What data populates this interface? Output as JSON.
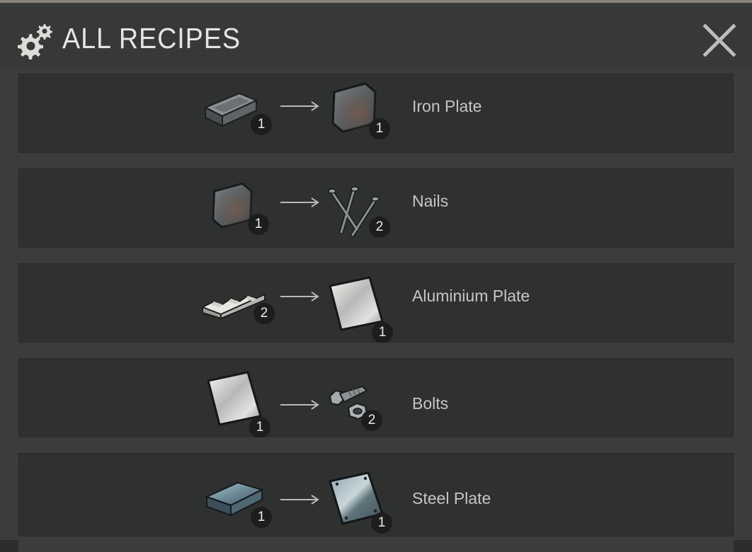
{
  "window": {
    "title": "ALL RECIPES",
    "title_icon": "gears-icon",
    "close_icon": "close-icon"
  },
  "recipes": [
    {
      "input": {
        "icon": "iron-ingot-icon",
        "count": "1"
      },
      "output": {
        "icon": "iron-plate-icon",
        "count": "1"
      },
      "name": "Iron Plate"
    },
    {
      "input": {
        "icon": "iron-plate-icon",
        "count": "1"
      },
      "output": {
        "icon": "nails-icon",
        "count": "2"
      },
      "name": "Nails"
    },
    {
      "input": {
        "icon": "aluminium-ingots-icon",
        "count": "2"
      },
      "output": {
        "icon": "aluminium-plate-icon",
        "count": "1"
      },
      "name": "Aluminium Plate"
    },
    {
      "input": {
        "icon": "aluminium-plate-icon",
        "count": "1"
      },
      "output": {
        "icon": "bolts-icon",
        "count": "2"
      },
      "name": "Bolts"
    },
    {
      "input": {
        "icon": "steel-ingot-icon",
        "count": "1"
      },
      "output": {
        "icon": "steel-plate-icon",
        "count": "1"
      },
      "name": "Steel Plate"
    }
  ],
  "colors": {
    "panel_bg": "#3a3d3c",
    "row_bg": "#2e312f",
    "title_text": "#e4e4e0",
    "recipe_text": "#c4c6c3",
    "badge_bg": "#1c1d1d"
  }
}
